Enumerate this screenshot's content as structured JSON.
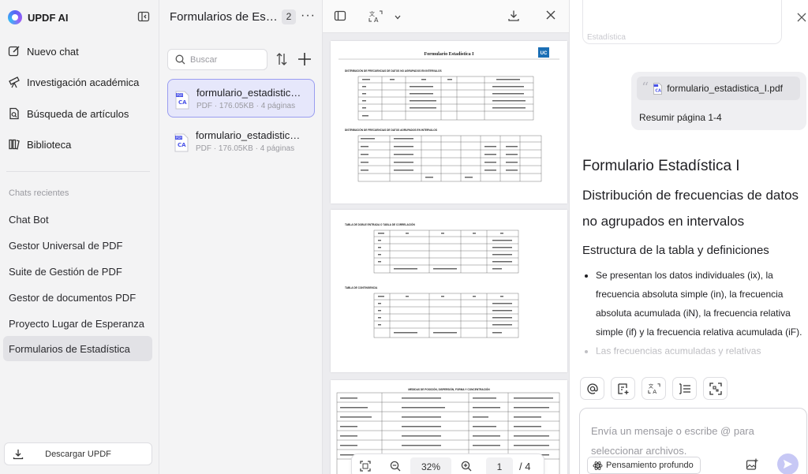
{
  "sidebar": {
    "brand": "UPDF AI",
    "nav": [
      {
        "label": "Nuevo chat",
        "icon": "edit-icon"
      },
      {
        "label": "Investigación académica",
        "icon": "telescope-icon"
      },
      {
        "label": "Búsqueda de artículos",
        "icon": "document-search-icon"
      },
      {
        "label": "Biblioteca",
        "icon": "library-icon"
      }
    ],
    "recent_title": "Chats recientes",
    "recent": [
      "Chat Bot",
      "Gestor Universal de PDF",
      "Suite de Gestión de PDF",
      "Gestor de documentos PDF",
      "Proyecto Lugar de Esperanza",
      "Formularios de Estadística"
    ],
    "active_recent_index": 5,
    "download_label": "Descargar UPDF"
  },
  "files": {
    "title": "Formularios de Estadística",
    "count": "2",
    "search_placeholder": "Buscar",
    "items": [
      {
        "name": "formulario_estadistica_I.pdf",
        "meta": "PDF · 176.05KB · 4 páginas",
        "selected": true
      },
      {
        "name": "formulario_estadistica_II.pdf",
        "meta": "PDF · 176.05KB · 4 páginas",
        "selected": false
      }
    ]
  },
  "viewer": {
    "zoom": "32%",
    "current_page": "1",
    "total_pages": "/ 4",
    "page1_title": "Formulario Estadística I",
    "page1_logo": "UC",
    "page1_sections": [
      "DISTRIBUCIÓN DE FRECUENCIAS DE DATOS NO AGRUPADOS EN INTERVALOS",
      "DISTRIBUCIÓN DE FRECUENCIAS DE DATOS AGRUPADOS EN INTERVALOS"
    ],
    "page2_sections": [
      "TABLA DE DOBLE ENTRADA O TABLA DE CORRELACIÓN",
      "TABLA DE CONTINGENCIA"
    ],
    "page3_heading": "MEDIDAS DE POSICIÓN, DISPERSIÓN, FORMA Y CONCENTRACIÓN"
  },
  "chat": {
    "prev_text": "Estadística",
    "attachment": "formulario_estadistica_I.pdf",
    "user_text": "Resumir página 1-4",
    "answer": {
      "h1": "Formulario Estadística I",
      "h2": "Distribución de frecuencias de datos no agrupados en intervalos",
      "h3": "Estructura de la tabla y definiciones",
      "bullets": [
        "Se presentan los datos individuales (ix), la frecuencia absoluta simple (in), la frecuencia absoluta acumulada (iN), la frecuencia relativa simple (if) y la frecuencia relativa acumulada (iF).",
        "Las frecuencias acumuladas y relativas"
      ]
    },
    "tools": [
      "at-icon",
      "add-note-icon",
      "translate-icon",
      "summary-icon",
      "scan-icon"
    ],
    "composer_placeholder": "Envía un mensaje o escribe @ para seleccionar archivos.",
    "deep_think_label": "Pensamiento profundo"
  }
}
